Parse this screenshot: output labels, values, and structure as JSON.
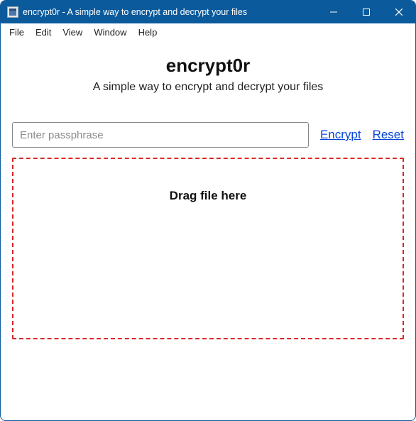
{
  "window": {
    "title": "encrypt0r - A simple way to encrypt and decrypt your files",
    "icon_name": "app-icon"
  },
  "win_controls": {
    "minimize": "minimize",
    "maximize": "maximize",
    "close": "close"
  },
  "menubar": {
    "items": [
      "File",
      "Edit",
      "View",
      "Window",
      "Help"
    ]
  },
  "header": {
    "title": "encrypt0r",
    "subtitle": "A simple way to encrypt and decrypt your files"
  },
  "form": {
    "passphrase_placeholder": "Enter passphrase",
    "passphrase_value": "",
    "encrypt_label": "Encrypt",
    "reset_label": "Reset"
  },
  "dropzone": {
    "label": "Drag file here"
  },
  "colors": {
    "titlebar": "#0a5a9c",
    "link": "#0645d8",
    "dropzone_border": "#d82a2a"
  }
}
